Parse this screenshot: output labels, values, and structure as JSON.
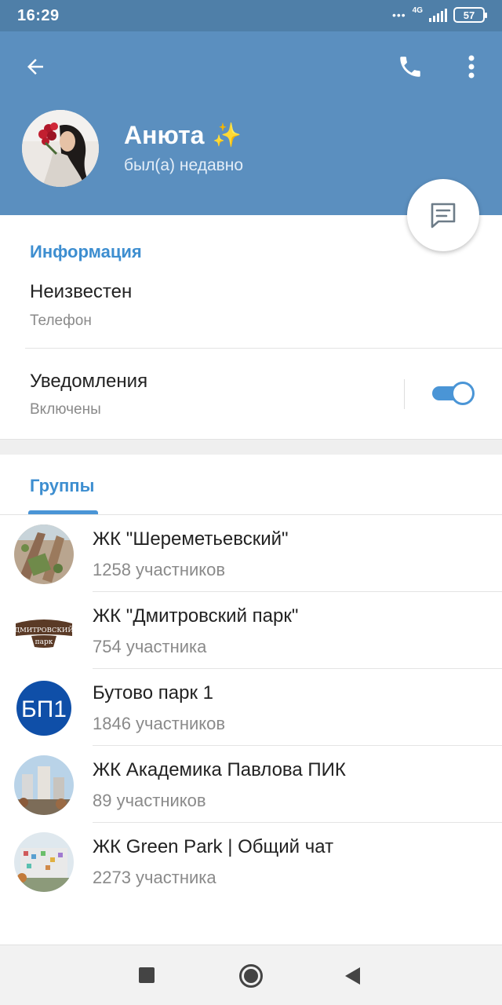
{
  "status_bar": {
    "time": "16:29",
    "network": "4G",
    "battery": "57"
  },
  "header": {
    "back_icon": "arrow-left-icon",
    "call_icon": "phone-icon",
    "menu_icon": "more-vertical-icon",
    "name": "Анюта",
    "emoji": "✨",
    "last_seen": "был(а) недавно",
    "message_icon": "message-icon",
    "bg_color": "#5b8fbf"
  },
  "info": {
    "title": "Информация",
    "phone_value": "Неизвестен",
    "phone_label": "Телефон",
    "notifications_label": "Уведомления",
    "notifications_status": "Включены",
    "notifications_enabled": true
  },
  "groups": {
    "tab_label": "Группы",
    "items": [
      {
        "name": "ЖК \"Шереметьевский\"",
        "count": "1258 участников"
      },
      {
        "name": "ЖК \"Дмитровский парк\"",
        "count": "754 участника"
      },
      {
        "name": "Бутово парк 1",
        "count": "1846 участников"
      },
      {
        "name": "ЖК Академика Павлова ПИК",
        "count": "89 участников"
      },
      {
        "name": "ЖК Green Park | Общий чат",
        "count": "2273 участника"
      }
    ],
    "logo_texts": {
      "dmitrovsky_top": "ДМИТРОВСКИЙ",
      "dmitrovsky_bottom": "парк",
      "butovo": "БП1"
    }
  },
  "accent_color": "#3d8ed0"
}
